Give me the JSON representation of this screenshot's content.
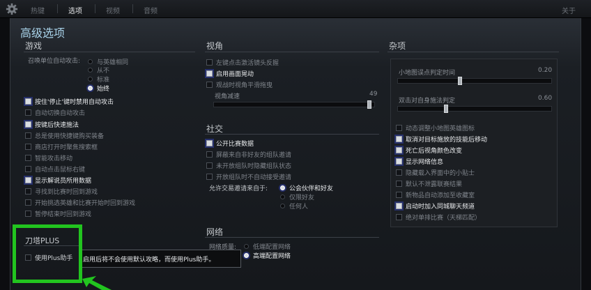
{
  "topbar": {
    "tabs": [
      {
        "label": "热键",
        "active": false
      },
      {
        "label": "选项",
        "active": true
      },
      {
        "label": "视频",
        "active": false
      },
      {
        "label": "音频",
        "active": false
      }
    ],
    "about": "关于"
  },
  "panel": {
    "title": "高级选项"
  },
  "game": {
    "title": "游戏",
    "summon_label": "召唤单位自动攻击:",
    "summon_options": [
      "与英雄相同",
      "从不",
      "标准",
      "始终"
    ],
    "summon_selected": 3,
    "options": [
      {
        "label": "按住'停止'键时禁用自动攻击",
        "checked": true
      },
      {
        "label": "自动切换自动攻击",
        "checked": false
      },
      {
        "label": "按键后快速施法",
        "checked": true
      },
      {
        "label": "总是使用快捷键购买装备",
        "checked": false
      },
      {
        "label": "商店打开时聚焦搜索框",
        "checked": false
      },
      {
        "label": "智能攻击移动",
        "checked": false
      },
      {
        "label": "自动点击鼠标右键",
        "checked": false
      },
      {
        "label": "显示解说员所用数据",
        "checked": true
      },
      {
        "label": "寻找到比赛时回到游戏",
        "checked": false
      },
      {
        "label": "开始挑选英雄和比赛开始时回到游戏",
        "checked": false
      },
      {
        "label": "暂停结束时回到游戏",
        "checked": false
      }
    ]
  },
  "plus": {
    "title": "刀塔PLUS",
    "option": {
      "label": "使用Plus助手",
      "checked": false
    },
    "tooltip": "启用后将不会使用默认攻略，而使用Plus助手。"
  },
  "camera": {
    "title": "视角",
    "options": [
      {
        "label": "左键点击激活镜头反握",
        "checked": false
      },
      {
        "label": "启用画面晃动",
        "checked": true
      },
      {
        "label": "观战时视角平滑拖曳",
        "checked": false
      }
    ],
    "slider": {
      "label": "视角减速",
      "value": "49",
      "fraction": 0.98
    }
  },
  "social": {
    "title": "社交",
    "options": [
      {
        "label": "公开比赛数据",
        "checked": true
      },
      {
        "label": "屏蔽来自非好友的组队邀请",
        "checked": false
      },
      {
        "label": "未开放组队时隐藏组队状态",
        "checked": false
      },
      {
        "label": "开放组队时不自动接受邀请",
        "checked": false
      }
    ],
    "trade_label": "允许交易邀请来自于:",
    "trade_options": [
      "公会伙伴和好友",
      "仅限好友",
      "任何人"
    ],
    "trade_selected": 0
  },
  "network": {
    "title": "网络",
    "quality_label": "网络质量:",
    "quality_options": [
      "低端配置网络",
      "高端配置网络"
    ],
    "quality_selected": 1
  },
  "misc": {
    "title": "杂项",
    "sliders": [
      {
        "label": "小地图误点判定时间",
        "value": "0.20",
        "fraction": 0.4
      },
      {
        "label": "双击对自身施法判定",
        "value": "0.60",
        "fraction": 0.31
      }
    ],
    "options": [
      {
        "label": "动态调整小地图英雄图标",
        "checked": false
      },
      {
        "label": "取消对目标施放的技能后移动",
        "checked": true
      },
      {
        "label": "死亡后视角颜色改变",
        "checked": true
      },
      {
        "label": "显示网络信息",
        "checked": true
      },
      {
        "label": "隐藏载入界面中的小贴士",
        "checked": false
      },
      {
        "label": "默认不泄露联赛结果",
        "checked": false
      },
      {
        "label": "新物品自动添加至收藏室",
        "checked": false
      },
      {
        "label": "启动时加入同城聊天频道",
        "checked": true
      },
      {
        "label": "绝对单排比赛（天梯匹配）",
        "checked": false
      }
    ]
  },
  "colors": {
    "highlight": "#22c41f",
    "title_blue": "#a9d3ea",
    "focus_ring": "#26306c"
  }
}
